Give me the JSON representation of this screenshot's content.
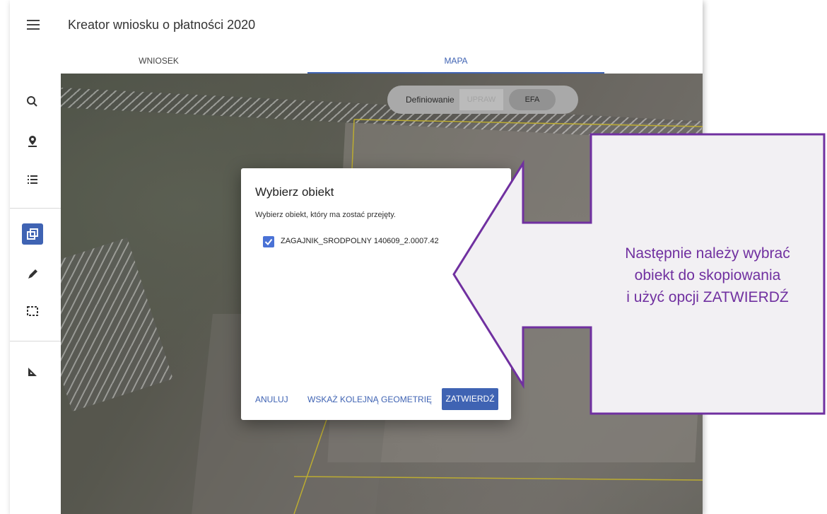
{
  "app": {
    "title": "Kreator wniosku o płatności 2020"
  },
  "tabs": [
    {
      "label": "WNIOSEK",
      "active": false
    },
    {
      "label": "MAPA",
      "active": true
    }
  ],
  "map": {
    "toggle": {
      "label": "Definiowanie",
      "option1": "UPRAW",
      "option2": "EFA"
    }
  },
  "sidebar": {
    "icons": [
      "search-icon",
      "location-icon",
      "list-icon",
      "copy-icon",
      "pencil-icon",
      "selection-icon",
      "ruler-icon"
    ],
    "active_icon": "copy-icon"
  },
  "dialog": {
    "title": "Wybierz obiekt",
    "subtitle": "Wybierz obiekt, który ma zostać przejęty.",
    "item_label": "ZAGAJNIK_SRODPOLNY 140609_2.0007.42",
    "item_checked": true,
    "cancel_label": "ANULUJ",
    "next_label": "WSKAŻ KOLEJNĄ GEOMETRIĘ",
    "confirm_label": "ZATWIERDŹ"
  },
  "callout": {
    "line1": "Następnie należy wybrać",
    "line2": "obiekt do skopiowania",
    "line3": "i użyć opcji ZATWIERDŹ"
  },
  "colors": {
    "accent": "#3f63b3",
    "callout_text": "#7030a0",
    "callout_border": "#7030a0",
    "callout_fill": "#f2f0f3"
  }
}
